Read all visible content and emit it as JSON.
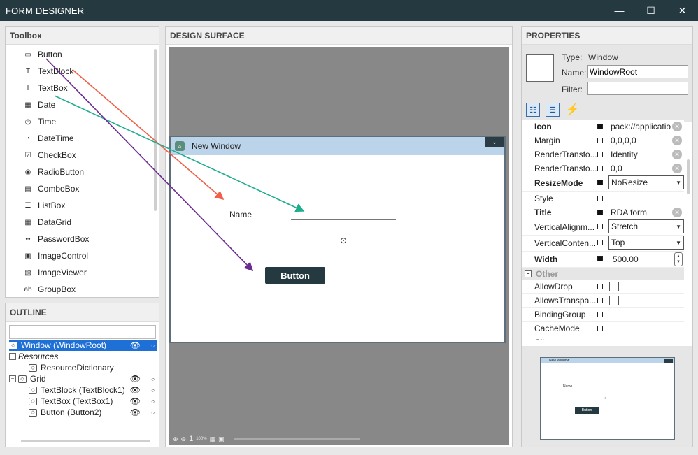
{
  "app": {
    "title": "FORM DESIGNER",
    "min_glyph": "—",
    "max_glyph": "☐",
    "close_glyph": "✕"
  },
  "toolbox": {
    "header": "Toolbox",
    "items": [
      {
        "label": "Button",
        "icon": "button-icon",
        "glyph": "▭"
      },
      {
        "label": "TextBlock",
        "icon": "textblock-icon",
        "glyph": "T"
      },
      {
        "label": "TextBox",
        "icon": "textbox-icon",
        "glyph": "I"
      },
      {
        "label": "Date",
        "icon": "calendar-icon",
        "glyph": "▦"
      },
      {
        "label": "Time",
        "icon": "clock-icon",
        "glyph": "◷"
      },
      {
        "label": "DateTime",
        "icon": "datetime-icon",
        "glyph": "◔"
      },
      {
        "label": "CheckBox",
        "icon": "checkbox-icon",
        "glyph": "☑"
      },
      {
        "label": "RadioButton",
        "icon": "radiobutton-icon",
        "glyph": "◉"
      },
      {
        "label": "ComboBox",
        "icon": "combobox-icon",
        "glyph": "▤"
      },
      {
        "label": "ListBox",
        "icon": "listbox-icon",
        "glyph": "☰"
      },
      {
        "label": "DataGrid",
        "icon": "datagrid-icon",
        "glyph": "▦"
      },
      {
        "label": "PasswordBox",
        "icon": "passwordbox-icon",
        "glyph": "••"
      },
      {
        "label": "ImageControl",
        "icon": "image-icon",
        "glyph": "▣"
      },
      {
        "label": "ImageViewer",
        "icon": "imageviewer-icon",
        "glyph": "▧"
      },
      {
        "label": "GroupBox",
        "icon": "groupbox-icon",
        "glyph": "ab"
      }
    ]
  },
  "outline": {
    "header": "OUTLINE",
    "search_value": "",
    "rows": [
      {
        "label": "Window (WindowRoot)",
        "selected": true,
        "eye": true,
        "dot": true,
        "italic": false
      },
      {
        "label": "Resources",
        "selected": false,
        "eye": false,
        "dot": false,
        "italic": true
      },
      {
        "label": "ResourceDictionary",
        "selected": false,
        "eye": false,
        "dot": false,
        "italic": false
      },
      {
        "label": "Grid",
        "selected": false,
        "eye": true,
        "dot": true,
        "italic": false
      },
      {
        "label": "TextBlock (TextBlock1)",
        "selected": false,
        "eye": true,
        "dot": true,
        "italic": false
      },
      {
        "label": "TextBox (TextBox1)",
        "selected": false,
        "eye": true,
        "dot": true,
        "italic": false
      },
      {
        "label": "Button (Button2)",
        "selected": false,
        "eye": true,
        "dot": true,
        "italic": false
      }
    ]
  },
  "design": {
    "header": "DESIGN SURFACE",
    "window_title": "New Window",
    "name_label": "Name",
    "button_label": "Button",
    "zoom_page": "1",
    "zoom_percent": "100%"
  },
  "properties": {
    "header": "PROPERTIES",
    "type_label": "Type:",
    "type_value": "Window",
    "name_label": "Name:",
    "name_value": "WindowRoot",
    "filter_label": "Filter:",
    "filter_value": "",
    "rows": [
      {
        "name": "Icon",
        "bold": true,
        "filled": true,
        "kind": "text",
        "value": "pack://applicatio",
        "reset": true
      },
      {
        "name": "Margin",
        "bold": false,
        "filled": false,
        "kind": "text",
        "value": "0,0,0,0",
        "reset": true
      },
      {
        "name": "RenderTransfo...",
        "bold": false,
        "filled": false,
        "kind": "text",
        "value": "Identity",
        "reset": true
      },
      {
        "name": "RenderTransfo...",
        "bold": false,
        "filled": false,
        "kind": "text",
        "value": "0,0",
        "reset": true
      },
      {
        "name": "ResizeMode",
        "bold": true,
        "filled": true,
        "kind": "select",
        "value": "NoResize",
        "reset": false
      },
      {
        "name": "Style",
        "bold": false,
        "filled": false,
        "kind": "text",
        "value": "",
        "reset": false
      },
      {
        "name": "Title",
        "bold": true,
        "filled": true,
        "kind": "text",
        "value": "RDA form",
        "reset": true
      },
      {
        "name": "VerticalAlignm...",
        "bold": false,
        "filled": false,
        "kind": "select",
        "value": "Stretch",
        "reset": false
      },
      {
        "name": "VerticalConten...",
        "bold": false,
        "filled": false,
        "kind": "select",
        "value": "Top",
        "reset": false
      },
      {
        "name": "Width",
        "bold": true,
        "filled": true,
        "kind": "spinner",
        "value": "500.00",
        "reset": false
      }
    ],
    "category": "Other",
    "other_rows": [
      {
        "name": "AllowDrop",
        "kind": "check"
      },
      {
        "name": "AllowsTranspa...",
        "kind": "check"
      },
      {
        "name": "BindingGroup",
        "kind": "text"
      },
      {
        "name": "CacheMode",
        "kind": "text"
      },
      {
        "name": "Clip",
        "kind": "text"
      }
    ],
    "preview": {
      "title": "New Window",
      "name_label": "Name",
      "button_label": "Button"
    }
  },
  "colors": {
    "titlebar": "#253a40",
    "selection": "#1e6fd6",
    "connector_red": "#f0604a",
    "connector_green": "#1eae8e",
    "connector_purple": "#6a2c91"
  }
}
